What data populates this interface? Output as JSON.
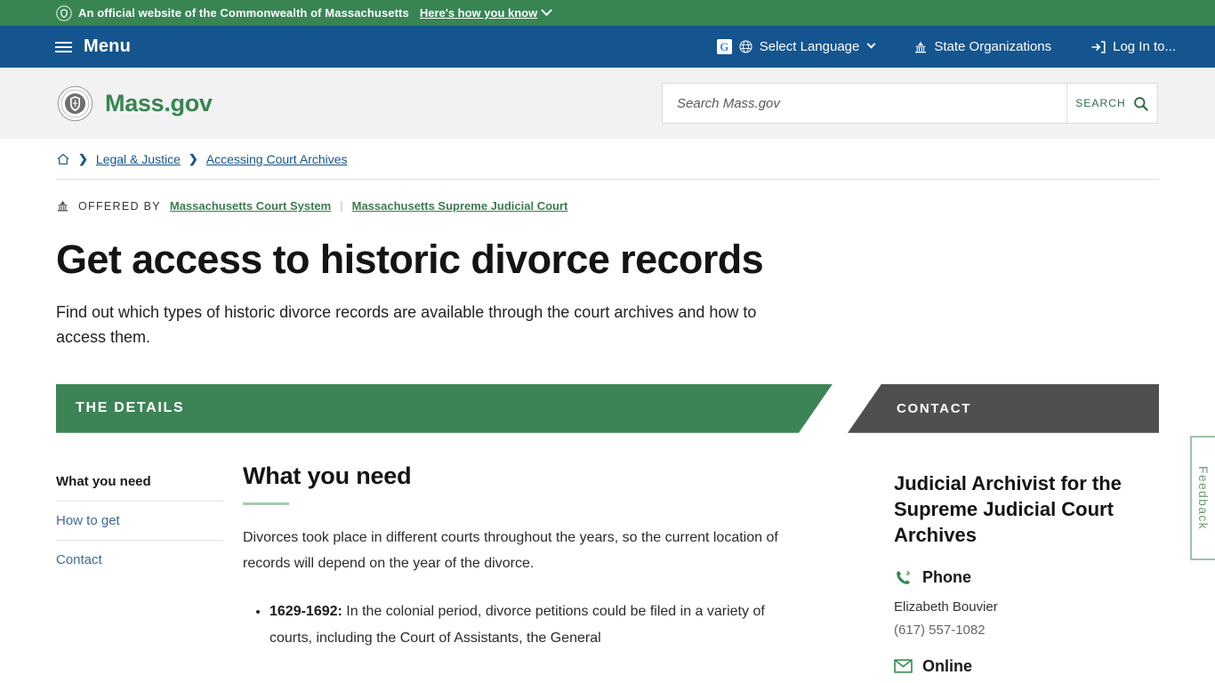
{
  "gov_banner": {
    "text": "An official website of the Commonwealth of Massachusetts",
    "how_you_know": "Here's how you know",
    "shield_icon": "shield-icon",
    "chevron_icon": "chevron-down-icon"
  },
  "mainnav": {
    "menu_label": "Menu",
    "hamburger_icon": "hamburger-icon",
    "items": [
      {
        "label": "Select Language",
        "icon": "globe-icon",
        "extra_icon": "google-logo-icon",
        "chevron": "chevron-down-icon"
      },
      {
        "label": "State Organizations",
        "icon": "capitol-icon"
      },
      {
        "label": "Log In to...",
        "icon": "login-icon"
      }
    ]
  },
  "brand": {
    "name": "Mass.gov",
    "seal_icon": "massachusetts-seal-icon"
  },
  "search": {
    "placeholder": "Search Mass.gov",
    "value": "",
    "button_label": "SEARCH",
    "button_icon": "magnifier-icon"
  },
  "breadcrumb": {
    "home_icon": "home-icon",
    "separator": "❯",
    "items": [
      {
        "label": "Legal & Justice"
      },
      {
        "label": "Accessing Court Archives"
      }
    ]
  },
  "offered_by": {
    "icon": "capitol-icon",
    "label": "OFFERED BY",
    "separator": "|",
    "organizations": [
      "Massachusetts Court System",
      "Massachusetts Supreme Judicial Court"
    ]
  },
  "page": {
    "title": "Get access to historic divorce records",
    "subtitle": "Find out which types of historic divorce records are available through the court archives and how to access them."
  },
  "banners": {
    "details_label": "THE DETAILS",
    "contact_label": "CONTACT",
    "details_color": "#3c8456",
    "contact_color": "#4f4f4f"
  },
  "sidenav": {
    "items": [
      {
        "label": "What you need",
        "active": true
      },
      {
        "label": "How to get",
        "active": false
      },
      {
        "label": "Contact",
        "active": false
      }
    ]
  },
  "main": {
    "heading": "What you need",
    "paragraph": "Divorces took place in different courts throughout the years, so the current location of records will depend on the year of the divorce.",
    "bullets": [
      {
        "term": "1629-1692:",
        "text": " In the colonial period, divorce petitions could be filed in a variety of courts, including the Court of Assistants, the General"
      }
    ]
  },
  "contact": {
    "name": "Judicial Archivist for the Supreme Judicial Court Archives",
    "phone": {
      "icon": "phone-icon",
      "label": "Phone",
      "contact_name": "Elizabeth Bouvier",
      "number": "(617) 557-1082"
    },
    "online": {
      "icon": "envelope-icon",
      "label": "Online"
    }
  },
  "feedback": {
    "label": "Feedback"
  }
}
